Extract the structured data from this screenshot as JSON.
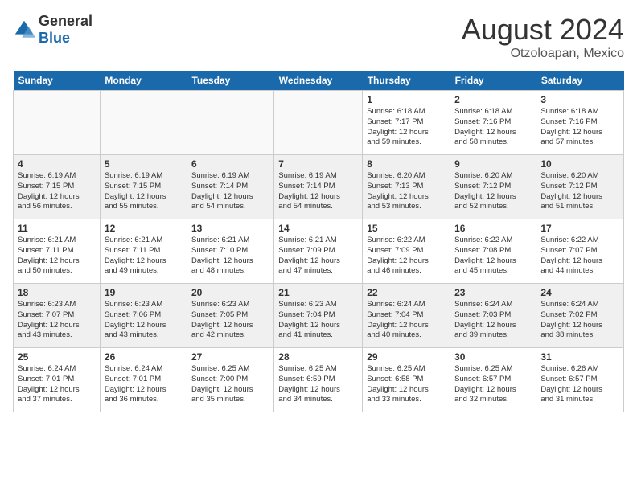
{
  "header": {
    "logo_general": "General",
    "logo_blue": "Blue",
    "month_year": "August 2024",
    "location": "Otzoloapan, Mexico"
  },
  "weekdays": [
    "Sunday",
    "Monday",
    "Tuesday",
    "Wednesday",
    "Thursday",
    "Friday",
    "Saturday"
  ],
  "weeks": [
    [
      {
        "day": "",
        "info": ""
      },
      {
        "day": "",
        "info": ""
      },
      {
        "day": "",
        "info": ""
      },
      {
        "day": "",
        "info": ""
      },
      {
        "day": "1",
        "info": "Sunrise: 6:18 AM\nSunset: 7:17 PM\nDaylight: 12 hours\nand 59 minutes."
      },
      {
        "day": "2",
        "info": "Sunrise: 6:18 AM\nSunset: 7:16 PM\nDaylight: 12 hours\nand 58 minutes."
      },
      {
        "day": "3",
        "info": "Sunrise: 6:18 AM\nSunset: 7:16 PM\nDaylight: 12 hours\nand 57 minutes."
      }
    ],
    [
      {
        "day": "4",
        "info": "Sunrise: 6:19 AM\nSunset: 7:15 PM\nDaylight: 12 hours\nand 56 minutes."
      },
      {
        "day": "5",
        "info": "Sunrise: 6:19 AM\nSunset: 7:15 PM\nDaylight: 12 hours\nand 55 minutes."
      },
      {
        "day": "6",
        "info": "Sunrise: 6:19 AM\nSunset: 7:14 PM\nDaylight: 12 hours\nand 54 minutes."
      },
      {
        "day": "7",
        "info": "Sunrise: 6:19 AM\nSunset: 7:14 PM\nDaylight: 12 hours\nand 54 minutes."
      },
      {
        "day": "8",
        "info": "Sunrise: 6:20 AM\nSunset: 7:13 PM\nDaylight: 12 hours\nand 53 minutes."
      },
      {
        "day": "9",
        "info": "Sunrise: 6:20 AM\nSunset: 7:12 PM\nDaylight: 12 hours\nand 52 minutes."
      },
      {
        "day": "10",
        "info": "Sunrise: 6:20 AM\nSunset: 7:12 PM\nDaylight: 12 hours\nand 51 minutes."
      }
    ],
    [
      {
        "day": "11",
        "info": "Sunrise: 6:21 AM\nSunset: 7:11 PM\nDaylight: 12 hours\nand 50 minutes."
      },
      {
        "day": "12",
        "info": "Sunrise: 6:21 AM\nSunset: 7:11 PM\nDaylight: 12 hours\nand 49 minutes."
      },
      {
        "day": "13",
        "info": "Sunrise: 6:21 AM\nSunset: 7:10 PM\nDaylight: 12 hours\nand 48 minutes."
      },
      {
        "day": "14",
        "info": "Sunrise: 6:21 AM\nSunset: 7:09 PM\nDaylight: 12 hours\nand 47 minutes."
      },
      {
        "day": "15",
        "info": "Sunrise: 6:22 AM\nSunset: 7:09 PM\nDaylight: 12 hours\nand 46 minutes."
      },
      {
        "day": "16",
        "info": "Sunrise: 6:22 AM\nSunset: 7:08 PM\nDaylight: 12 hours\nand 45 minutes."
      },
      {
        "day": "17",
        "info": "Sunrise: 6:22 AM\nSunset: 7:07 PM\nDaylight: 12 hours\nand 44 minutes."
      }
    ],
    [
      {
        "day": "18",
        "info": "Sunrise: 6:23 AM\nSunset: 7:07 PM\nDaylight: 12 hours\nand 43 minutes."
      },
      {
        "day": "19",
        "info": "Sunrise: 6:23 AM\nSunset: 7:06 PM\nDaylight: 12 hours\nand 43 minutes."
      },
      {
        "day": "20",
        "info": "Sunrise: 6:23 AM\nSunset: 7:05 PM\nDaylight: 12 hours\nand 42 minutes."
      },
      {
        "day": "21",
        "info": "Sunrise: 6:23 AM\nSunset: 7:04 PM\nDaylight: 12 hours\nand 41 minutes."
      },
      {
        "day": "22",
        "info": "Sunrise: 6:24 AM\nSunset: 7:04 PM\nDaylight: 12 hours\nand 40 minutes."
      },
      {
        "day": "23",
        "info": "Sunrise: 6:24 AM\nSunset: 7:03 PM\nDaylight: 12 hours\nand 39 minutes."
      },
      {
        "day": "24",
        "info": "Sunrise: 6:24 AM\nSunset: 7:02 PM\nDaylight: 12 hours\nand 38 minutes."
      }
    ],
    [
      {
        "day": "25",
        "info": "Sunrise: 6:24 AM\nSunset: 7:01 PM\nDaylight: 12 hours\nand 37 minutes."
      },
      {
        "day": "26",
        "info": "Sunrise: 6:24 AM\nSunset: 7:01 PM\nDaylight: 12 hours\nand 36 minutes."
      },
      {
        "day": "27",
        "info": "Sunrise: 6:25 AM\nSunset: 7:00 PM\nDaylight: 12 hours\nand 35 minutes."
      },
      {
        "day": "28",
        "info": "Sunrise: 6:25 AM\nSunset: 6:59 PM\nDaylight: 12 hours\nand 34 minutes."
      },
      {
        "day": "29",
        "info": "Sunrise: 6:25 AM\nSunset: 6:58 PM\nDaylight: 12 hours\nand 33 minutes."
      },
      {
        "day": "30",
        "info": "Sunrise: 6:25 AM\nSunset: 6:57 PM\nDaylight: 12 hours\nand 32 minutes."
      },
      {
        "day": "31",
        "info": "Sunrise: 6:26 AM\nSunset: 6:57 PM\nDaylight: 12 hours\nand 31 minutes."
      }
    ]
  ]
}
